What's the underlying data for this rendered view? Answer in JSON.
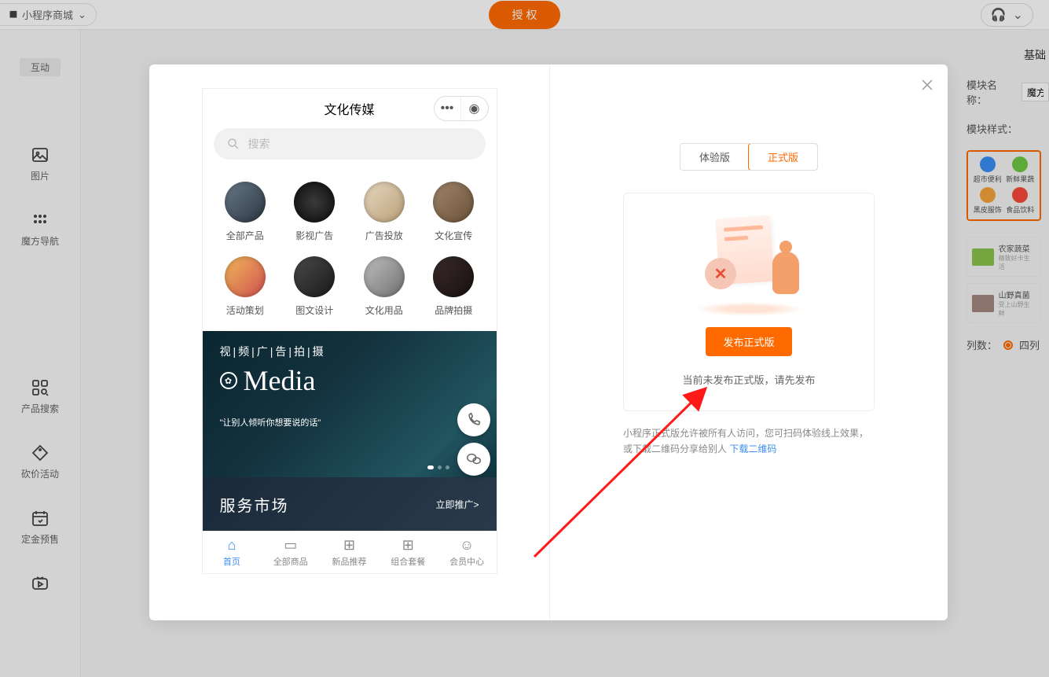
{
  "topbar": {
    "app_name": "小程序商城",
    "auth_btn": "授 权"
  },
  "sidebar": {
    "tag": "互动",
    "items": [
      {
        "label": "图片"
      },
      {
        "label": "魔方导航"
      },
      {
        "label": "产品搜索"
      },
      {
        "label": "砍价活动"
      },
      {
        "label": "定金预售"
      }
    ]
  },
  "right": {
    "basic": "基础",
    "module_name_label": "模块名称：",
    "module_name_value": "魔方",
    "module_style_label": "模块样式：",
    "style_icons": [
      "超市便利",
      "新鲜果蔬",
      "黑皮服饰",
      "食品饮料"
    ],
    "list_items": [
      {
        "title": "农家蔬菜",
        "sub": "精致好卡生活"
      },
      {
        "title": "山野真菌",
        "sub": "受上山野生鲜"
      }
    ],
    "cols_label": "列数：",
    "cols_value": "四列"
  },
  "phone": {
    "title": "文化传媒",
    "search_placeholder": "搜索",
    "categories": [
      "全部产品",
      "影视广告",
      "广告投放",
      "文化宣传",
      "活动策划",
      "图文设计",
      "文化用品",
      "品牌拍摄"
    ],
    "banner_top": "视|频|广|告|拍|摄",
    "banner_title": "Media",
    "banner_sub": "\"让别人倾听你想要说的话\"",
    "service_title": "服务市场",
    "service_link": "立即推广>",
    "tabs": [
      "首页",
      "全部商品",
      "新品推荐",
      "组合套餐",
      "会员中心"
    ]
  },
  "publish": {
    "tab_trial": "体验版",
    "tab_official": "正式版",
    "btn": "发布正式版",
    "hint": "当前未发布正式版，请先发布",
    "desc_pre": "小程序正式版允许被所有人访问，您可扫码体验线上效果，或下载二维码分享给别人 ",
    "desc_link": "下载二维码"
  }
}
